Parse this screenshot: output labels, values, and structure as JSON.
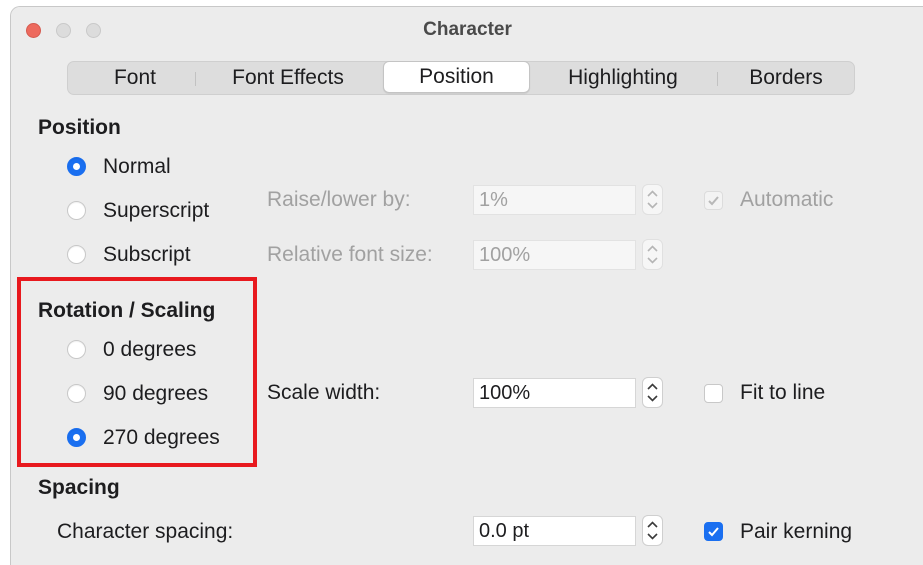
{
  "window": {
    "title": "Character"
  },
  "tabs": [
    {
      "label": "Font",
      "active": false
    },
    {
      "label": "Font Effects",
      "active": false
    },
    {
      "label": "Position",
      "active": true
    },
    {
      "label": "Highlighting",
      "active": false
    },
    {
      "label": "Borders",
      "active": false
    }
  ],
  "position": {
    "title": "Position",
    "options": [
      {
        "label": "Normal",
        "checked": true
      },
      {
        "label": "Superscript",
        "checked": false
      },
      {
        "label": "Subscript",
        "checked": false
      }
    ],
    "raise_lower": {
      "label": "Raise/lower by:",
      "value": "1%",
      "enabled": false
    },
    "relative_size": {
      "label": "Relative font size:",
      "value": "100%",
      "enabled": false
    },
    "automatic": {
      "label": "Automatic",
      "checked": true,
      "enabled": false
    }
  },
  "rotation": {
    "title": "Rotation / Scaling",
    "options": [
      {
        "label": "0 degrees",
        "checked": false
      },
      {
        "label": "90 degrees",
        "checked": false
      },
      {
        "label": "270 degrees",
        "checked": true
      }
    ],
    "scale_width": {
      "label": "Scale width:",
      "value": "100%"
    },
    "fit_to_line": {
      "label": "Fit to line",
      "checked": false
    }
  },
  "spacing": {
    "title": "Spacing",
    "character_spacing": {
      "label": "Character spacing:",
      "value": "0.0 pt"
    },
    "pair_kerning": {
      "label": "Pair kerning",
      "checked": true
    }
  },
  "colors": {
    "accent": "#1a6ff0",
    "highlight_border": "#e8191e",
    "close_button": "#ed6a5e"
  }
}
